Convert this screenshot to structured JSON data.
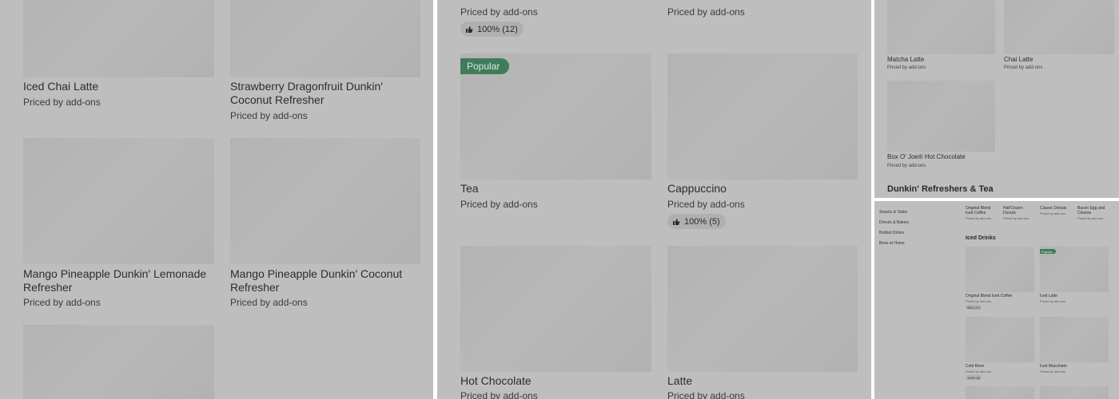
{
  "panel1": {
    "items": [
      {
        "name": "Iced Chai Latte",
        "price": "Priced by add-ons"
      },
      {
        "name": "Strawberry Dragonfruit Dunkin'",
        "name2": "Coconut Refresher",
        "price": "Priced by add-ons"
      },
      {
        "name": "Mango Pineapple Dunkin' Lemonade",
        "name2": "Refresher",
        "price": "Priced by add-ons"
      },
      {
        "name": "Mango Pineapple Dunkin' Coconut",
        "name2": "Refresher",
        "price": "Priced by add-ons"
      }
    ]
  },
  "panel2": {
    "top_prices": [
      "Priced by add-ons",
      "Priced by add-ons"
    ],
    "top_rating": "100% (12)",
    "popular_badge": "Popular",
    "items": [
      {
        "name": "Tea",
        "price": "Priced by add-ons"
      },
      {
        "name": "Cappuccino",
        "price": "Priced by add-ons",
        "rating": "100% (5)"
      },
      {
        "name": "Hot Chocolate",
        "price": "Priced by add-ons"
      },
      {
        "name": "Latte",
        "price": "Priced by add-ons"
      }
    ]
  },
  "panel3": {
    "items": [
      {
        "name": "Matcha Latte",
        "price": "Priced by add-ons"
      },
      {
        "name": "Chai Latte",
        "price": "Priced by add-ons"
      },
      {
        "name": "Box O' Joe® Hot Chocolate",
        "price": "Priced by add-ons"
      }
    ],
    "section_heading": "Dunkin' Refreshers & Tea"
  },
  "panel4": {
    "nav": [
      "Snacks & Sides",
      "Donuts & Bakery",
      "Bottled Drinks",
      "Brew at Home"
    ],
    "top_items": [
      {
        "name": "Original Blend",
        "name2": "Iced Coffee",
        "price": "Priced by add-ons"
      },
      {
        "name": "Half Dozen",
        "name2": "Donuts",
        "price": "Priced by add-ons"
      },
      {
        "name": "Classic Donuts",
        "name2": "",
        "price": "Priced by add-ons"
      },
      {
        "name": "Bacon Egg and",
        "name2": "Cheese",
        "price": "Priced by add-ons"
      }
    ],
    "section_heading": "Iced Drinks",
    "popular_badge": "Popular",
    "items": [
      {
        "name": "Original Blend Iced Coffee",
        "price": "Priced by add-ons",
        "rating": "98% (17)"
      },
      {
        "name": "Iced Latte",
        "price": "Priced by add-ons"
      },
      {
        "name": "Cold Brew",
        "price": "Priced by add-ons",
        "rating": "100% (3)"
      },
      {
        "name": "Iced Macchiato",
        "price": "Priced by add-ons"
      }
    ]
  },
  "icons": {
    "rating": "thumbs-up-icon"
  },
  "colors": {
    "overlay": "#bebebe",
    "placeholder": "#b4b4b4",
    "badge": "#3f7d5a"
  }
}
